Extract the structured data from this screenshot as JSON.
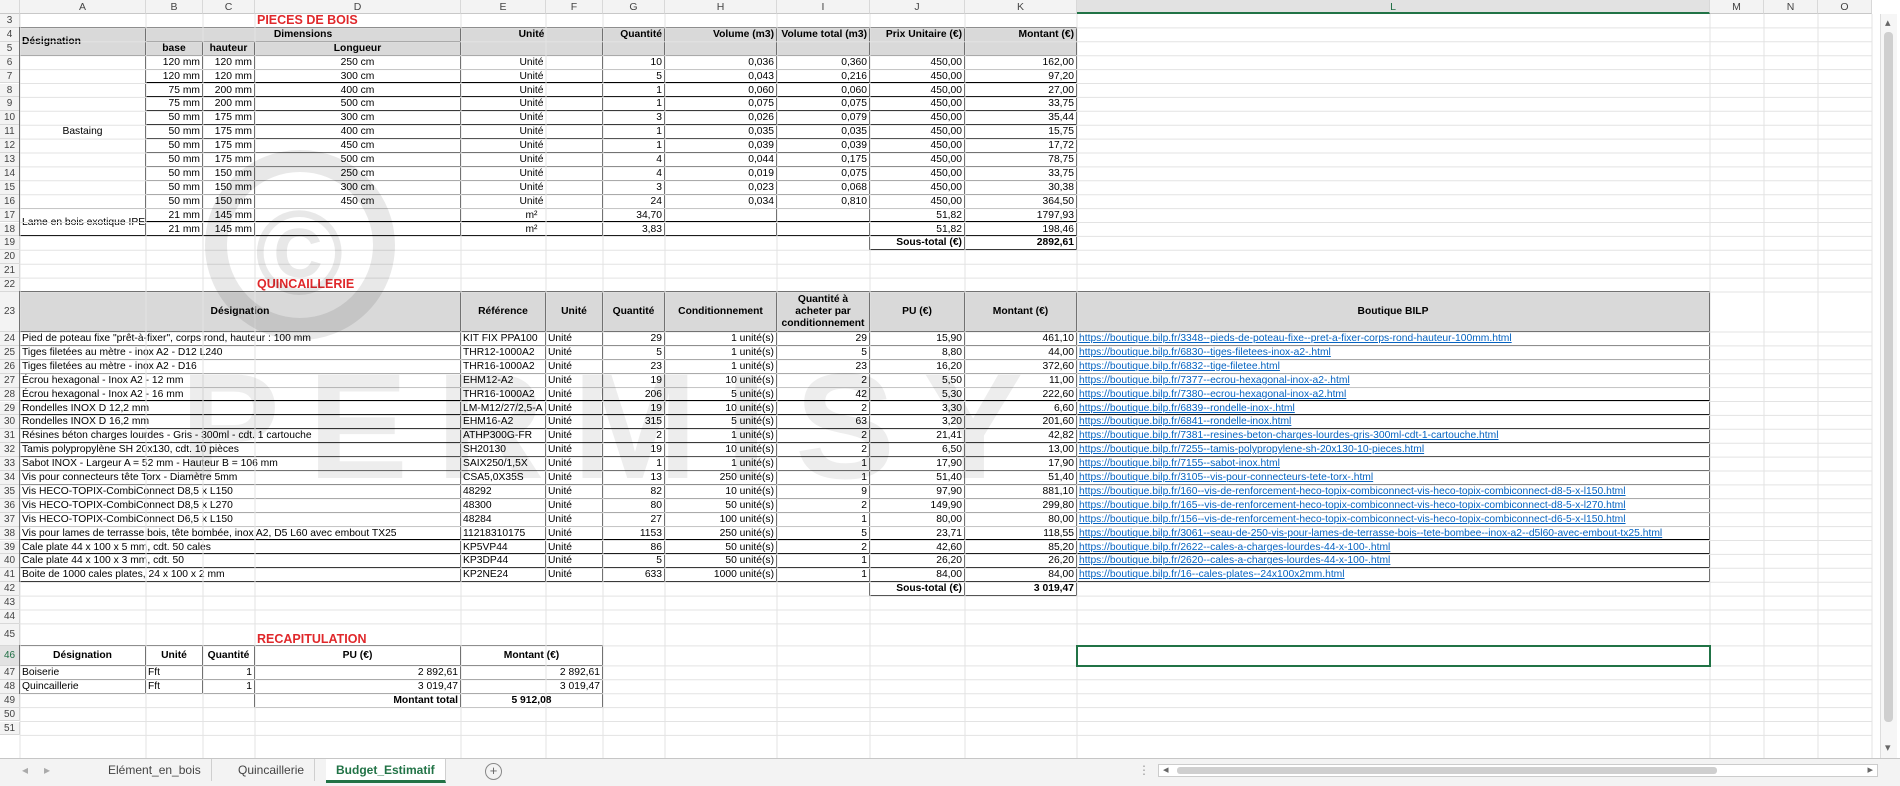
{
  "columns": [
    {
      "letter": "A"
    },
    {
      "letter": "B"
    },
    {
      "letter": "C"
    },
    {
      "letter": "D"
    },
    {
      "letter": "E"
    },
    {
      "letter": "F"
    },
    {
      "letter": "G"
    },
    {
      "letter": "H"
    },
    {
      "letter": "I"
    },
    {
      "letter": "J"
    },
    {
      "letter": "K"
    },
    {
      "letter": "L"
    },
    {
      "letter": "M"
    },
    {
      "letter": "N"
    },
    {
      "letter": "O"
    }
  ],
  "selected_column": "L",
  "selected_row": 46,
  "first_row": 3,
  "last_row": 51,
  "watermark": {
    "text": "PERMISY",
    "symbol": "©"
  },
  "bois": {
    "title": "PIECES DE BOIS",
    "headers": {
      "designation": "Désignation",
      "dimensions": "Dimensions",
      "base": "base",
      "hauteur": "hauteur",
      "longueur": "Longueur",
      "unite": "Unité",
      "quantite": "Quantité",
      "volume": "Volume (m3)",
      "volume_total": "Volume total (m3)",
      "prix_unitaire": "Prix Unitaire (€)",
      "montant": "Montant (€)"
    },
    "group1": "Bastaing",
    "group2": "Lame en bois exotique IPE",
    "rows": [
      {
        "row": 6,
        "base": "120 mm",
        "hauteur": "120 mm",
        "longueur": "250 cm",
        "unite": "Unité",
        "quantite": "10",
        "volume": "0,036",
        "volume_total": "0,360",
        "pu": "450,00",
        "montant": "162,00"
      },
      {
        "row": 7,
        "base": "120 mm",
        "hauteur": "120 mm",
        "longueur": "300 cm",
        "unite": "Unité",
        "quantite": "5",
        "volume": "0,043",
        "volume_total": "0,216",
        "pu": "450,00",
        "montant": "97,20"
      },
      {
        "row": 8,
        "base": "75 mm",
        "hauteur": "200 mm",
        "longueur": "400 cm",
        "unite": "Unité",
        "quantite": "1",
        "volume": "0,060",
        "volume_total": "0,060",
        "pu": "450,00",
        "montant": "27,00"
      },
      {
        "row": 9,
        "base": "75 mm",
        "hauteur": "200 mm",
        "longueur": "500 cm",
        "unite": "Unité",
        "quantite": "1",
        "volume": "0,075",
        "volume_total": "0,075",
        "pu": "450,00",
        "montant": "33,75"
      },
      {
        "row": 10,
        "base": "50 mm",
        "hauteur": "175 mm",
        "longueur": "300 cm",
        "unite": "Unité",
        "quantite": "3",
        "volume": "0,026",
        "volume_total": "0,079",
        "pu": "450,00",
        "montant": "35,44"
      },
      {
        "row": 11,
        "base": "50 mm",
        "hauteur": "175 mm",
        "longueur": "400 cm",
        "unite": "Unité",
        "quantite": "1",
        "volume": "0,035",
        "volume_total": "0,035",
        "pu": "450,00",
        "montant": "15,75"
      },
      {
        "row": 12,
        "base": "50 mm",
        "hauteur": "175 mm",
        "longueur": "450 cm",
        "unite": "Unité",
        "quantite": "1",
        "volume": "0,039",
        "volume_total": "0,039",
        "pu": "450,00",
        "montant": "17,72"
      },
      {
        "row": 13,
        "base": "50 mm",
        "hauteur": "175 mm",
        "longueur": "500 cm",
        "unite": "Unité",
        "quantite": "4",
        "volume": "0,044",
        "volume_total": "0,175",
        "pu": "450,00",
        "montant": "78,75"
      },
      {
        "row": 14,
        "base": "50 mm",
        "hauteur": "150 mm",
        "longueur": "250 cm",
        "unite": "Unité",
        "quantite": "4",
        "volume": "0,019",
        "volume_total": "0,075",
        "pu": "450,00",
        "montant": "33,75"
      },
      {
        "row": 15,
        "base": "50 mm",
        "hauteur": "150 mm",
        "longueur": "300 cm",
        "unite": "Unité",
        "quantite": "3",
        "volume": "0,023",
        "volume_total": "0,068",
        "pu": "450,00",
        "montant": "30,38"
      },
      {
        "row": 16,
        "base": "50 mm",
        "hauteur": "150 mm",
        "longueur": "450 cm",
        "unite": "Unité",
        "quantite": "24",
        "volume": "0,034",
        "volume_total": "0,810",
        "pu": "450,00",
        "montant": "364,50"
      },
      {
        "row": 17,
        "base": "21 mm",
        "hauteur": "145 mm",
        "longueur": "",
        "unite": "m²",
        "quantite": "34,70",
        "volume": "",
        "volume_total": "",
        "pu": "51,82",
        "montant": "1797,93"
      },
      {
        "row": 18,
        "base": "21 mm",
        "hauteur": "145 mm",
        "longueur": "",
        "unite": "m²",
        "quantite": "3,83",
        "volume": "",
        "volume_total": "",
        "pu": "51,82",
        "montant": "198,46"
      }
    ],
    "subtotal_label": "Sous-total (€)",
    "subtotal": "2892,61"
  },
  "quinc": {
    "title": "QUINCAILLERIE",
    "headers": {
      "designation": "Désignation",
      "reference": "Référence",
      "unite": "Unité",
      "quantite": "Quantité",
      "conditionnement": "Conditionnement",
      "qte_acheter": "Quantité à acheter par conditionnement",
      "pu": "PU (€)",
      "montant": "Montant (€)",
      "boutique": "Boutique BILP"
    },
    "rows": [
      {
        "row": 24,
        "designation": "Pied de poteau fixe \"prêt-à-fixer\", corps rond, hauteur : 100 mm",
        "reference": "KIT FIX PPA100",
        "unite": "Unité",
        "quantite": "29",
        "conditionnement": "1 unité(s)",
        "qte": "29",
        "pu": "15,90",
        "montant": "461,10",
        "lien": "https://boutique.bilp.fr/3348--pieds-de-poteau-fixe--pret-a-fixer-corps-rond-hauteur-100mm.html"
      },
      {
        "row": 25,
        "designation": "Tiges filetées au mètre - inox A2 - D12 L240",
        "reference": "THR12-1000A2",
        "unite": "Unité",
        "quantite": "5",
        "conditionnement": "1 unité(s)",
        "qte": "5",
        "pu": "8,80",
        "montant": "44,00",
        "lien": "https://boutique.bilp.fr/6830--tiges-filetees-inox-a2-.html"
      },
      {
        "row": 26,
        "designation": "Tiges filetées au mètre - inox A2 - D16",
        "reference": "THR16-1000A2",
        "unite": "Unité",
        "quantite": "23",
        "conditionnement": "1 unité(s)",
        "qte": "23",
        "pu": "16,20",
        "montant": "372,60",
        "lien": "https://boutique.bilp.fr/6832--tige-filetee.html"
      },
      {
        "row": 27,
        "designation": "Écrou hexagonal - Inox A2 - 12 mm",
        "reference": "EHM12-A2",
        "unite": "Unité",
        "quantite": "19",
        "conditionnement": "10 unité(s)",
        "qte": "2",
        "pu": "5,50",
        "montant": "11,00",
        "lien": "https://boutique.bilp.fr/7377--ecrou-hexagonal-inox-a2-.html"
      },
      {
        "row": 28,
        "designation": "Écrou hexagonal - Inox A2 - 16 mm",
        "reference": "THR16-1000A2",
        "unite": "Unité",
        "quantite": "206",
        "conditionnement": "5 unité(s)",
        "qte": "42",
        "pu": "5,30",
        "montant": "222,60",
        "lien": "https://boutique.bilp.fr/7380--ecrou-hexagonal-inox-a2.html"
      },
      {
        "row": 29,
        "designation": "Rondelles INOX D 12,2 mm",
        "reference": "LM-M12/27/2,5-A",
        "unite": "Unité",
        "quantite": "19",
        "conditionnement": "10 unité(s)",
        "qte": "2",
        "pu": "3,30",
        "montant": "6,60",
        "lien": "https://boutique.bilp.fr/6839--rondelle-inox-.html"
      },
      {
        "row": 30,
        "designation": "Rondelles INOX D 16,2 mm",
        "reference": "EHM16-A2",
        "unite": "Unité",
        "quantite": "315",
        "conditionnement": "5 unité(s)",
        "qte": "63",
        "pu": "3,20",
        "montant": "201,60",
        "lien": "https://boutique.bilp.fr/6841--rondelle-inox.html"
      },
      {
        "row": 31,
        "designation": "Résines béton charges lourdes - Gris - 300ml - cdt. 1 cartouche",
        "reference": "ATHP300G-FR",
        "unite": "Unité",
        "quantite": "2",
        "conditionnement": "1 unité(s)",
        "qte": "2",
        "pu": "21,41",
        "montant": "42,82",
        "lien": "https://boutique.bilp.fr/7381--resines-beton-charges-lourdes-gris-300ml-cdt-1-cartouche.html"
      },
      {
        "row": 32,
        "designation": "Tamis polypropylène SH 20x130, cdt. 10 pièces",
        "reference": "SH20130",
        "unite": "Unité",
        "quantite": "19",
        "conditionnement": "10 unité(s)",
        "qte": "2",
        "pu": "6,50",
        "montant": "13,00",
        "lien": "https://boutique.bilp.fr/7255--tamis-polypropylene-sh-20x130-10-pieces.html"
      },
      {
        "row": 33,
        "designation": "Sabot INOX - Largeur A = 52 mm - Hauteur B = 106 mm",
        "reference": "SAIX250/1,5X",
        "unite": "Unité",
        "quantite": "1",
        "conditionnement": "1 unité(s)",
        "qte": "1",
        "pu": "17,90",
        "montant": "17,90",
        "lien": "https://boutique.bilp.fr/7155--sabot-inox.html"
      },
      {
        "row": 34,
        "designation": "Vis pour connecteurs tête Torx - Diamètre 5mm",
        "reference": "CSA5,0X35S",
        "unite": "Unité",
        "quantite": "13",
        "conditionnement": "250 unité(s)",
        "qte": "1",
        "pu": "51,40",
        "montant": "51,40",
        "lien": "https://boutique.bilp.fr/3105--vis-pour-connecteurs-tete-torx-.html"
      },
      {
        "row": 35,
        "designation": "Vis HECO-TOPIX-CombiConnect D8,5 x L150",
        "reference": "48292",
        "unite": "Unité",
        "quantite": "82",
        "conditionnement": "10 unité(s)",
        "qte": "9",
        "pu": "97,90",
        "montant": "881,10",
        "lien": "https://boutique.bilp.fr/160--vis-de-renforcement-heco-topix-combiconnect-vis-heco-topix-combiconnect-d8-5-x-l150.html"
      },
      {
        "row": 36,
        "designation": "Vis HECO-TOPIX-CombiConnect D8,5 x L270",
        "reference": "48300",
        "unite": "Unité",
        "quantite": "80",
        "conditionnement": "50 unité(s)",
        "qte": "2",
        "pu": "149,90",
        "montant": "299,80",
        "lien": "https://boutique.bilp.fr/165--vis-de-renforcement-heco-topix-combiconnect-vis-heco-topix-combiconnect-d8-5-x-l270.html"
      },
      {
        "row": 37,
        "designation": "Vis HECO-TOPIX-CombiConnect D6,5 x L150",
        "reference": "48284",
        "unite": "Unité",
        "quantite": "27",
        "conditionnement": "100 unité(s)",
        "qte": "1",
        "pu": "80,00",
        "montant": "80,00",
        "lien": "https://boutique.bilp.fr/156--vis-de-renforcement-heco-topix-combiconnect-vis-heco-topix-combiconnect-d6-5-x-l150.html"
      },
      {
        "row": 38,
        "designation": "Vis pour lames de terrasse bois, tête bombée, inox A2, D5 L60 avec embout TX25",
        "reference": "11218310175",
        "unite": "Unité",
        "quantite": "1153",
        "conditionnement": "250 unité(s)",
        "qte": "5",
        "pu": "23,71",
        "montant": "118,55",
        "lien": "https://boutique.bilp.fr/3061--seau-de-250-vis-pour-lames-de-terrasse-bois--tete-bombee--inox-a2--d5l60-avec-embout-tx25.html"
      },
      {
        "row": 39,
        "designation": "Cale plate 44 x 100 x 5 mm, cdt. 50 cales",
        "reference": "KP5VP44",
        "unite": "Unité",
        "quantite": "86",
        "conditionnement": "50 unité(s)",
        "qte": "2",
        "pu": "42,60",
        "montant": "85,20",
        "lien": "https://boutique.bilp.fr/2622--cales-a-charges-lourdes-44-x-100-.html"
      },
      {
        "row": 40,
        "designation": "Cale plate 44 x 100 x 3 mm, cdt. 50",
        "reference": "KP3DP44",
        "unite": "Unité",
        "quantite": "5",
        "conditionnement": "50 unité(s)",
        "qte": "1",
        "pu": "26,20",
        "montant": "26,20",
        "lien": "https://boutique.bilp.fr/2620--cales-a-charges-lourdes-44-x-100-.html"
      },
      {
        "row": 41,
        "designation": "Boite de 1000 cales plates, 24 x 100 x 2 mm",
        "reference": "KP2NE24",
        "unite": "Unité",
        "quantite": "633",
        "conditionnement": "1000 unité(s)",
        "qte": "1",
        "pu": "84,00",
        "montant": "84,00",
        "lien": "https://boutique.bilp.fr/16--cales-plates--24x100x2mm.html"
      }
    ],
    "subtotal_label": "Sous-total (€)",
    "subtotal": "3 019,47"
  },
  "recap": {
    "title": "RECAPITULATION",
    "headers": {
      "designation": "Désignation",
      "unite": "Unité",
      "quantite": "Quantité",
      "pu": "PU (€)",
      "montant": "Montant (€)"
    },
    "rows": [
      {
        "designation": "Boiserie",
        "unite": "Fft",
        "quantite": "1",
        "pu": "2 892,61",
        "montant": "2 892,61"
      },
      {
        "designation": "Quincaillerie",
        "unite": "Fft",
        "quantite": "1",
        "pu": "3 019,47",
        "montant": "3 019,47"
      }
    ],
    "total_label": "Montant total",
    "total": "5 912,08"
  },
  "tabs": [
    {
      "label": "Elément_en_bois",
      "active": false
    },
    {
      "label": "Quincaillerie",
      "active": false
    },
    {
      "label": "Budget_Estimatif",
      "active": true
    }
  ],
  "icons": {
    "prev": "◂",
    "next": "▸",
    "add": "+",
    "more": "⋮",
    "scroll_left": "◂",
    "scroll_right": "▸",
    "scroll_up": "▴",
    "scroll_down": "▾"
  }
}
